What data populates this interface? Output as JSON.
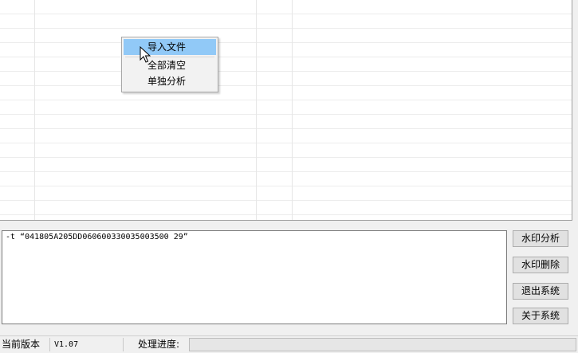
{
  "context_menu": {
    "items": [
      {
        "label": "导入文件",
        "highlighted": true
      },
      {
        "label": "全部清空",
        "highlighted": false
      },
      {
        "label": "单独分析",
        "highlighted": false
      }
    ]
  },
  "command": {
    "text": "-t “041805A205DD060600330035003500 29”"
  },
  "buttons": {
    "watermark_analyze": "水印分析",
    "watermark_delete": "水印删除",
    "exit_system": "退出系统",
    "about_system": "关于系统"
  },
  "status": {
    "version_label": "当前版本",
    "version_value": "V1.07",
    "progress_label": "处理进度:",
    "progress_value": 0
  },
  "colors": {
    "menu_highlight": "#91c9f7",
    "background": "#f0f0f0"
  }
}
